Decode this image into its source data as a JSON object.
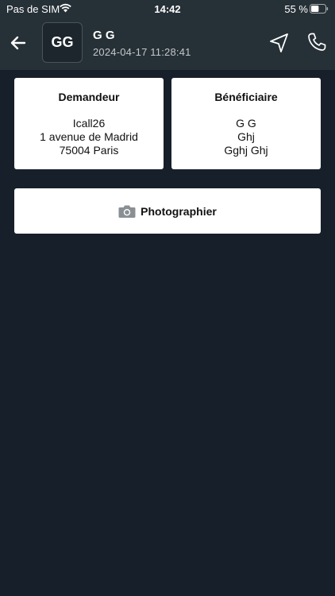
{
  "status_bar": {
    "carrier": "Pas de SIM",
    "time": "14:42",
    "battery_percent": "55 %",
    "battery_level": 0.55
  },
  "header": {
    "avatar_initials": "GG",
    "title": "G G",
    "timestamp": "2024-04-17 11:28:41"
  },
  "requester": {
    "heading": "Demandeur",
    "lines": [
      "Icall26",
      "1 avenue de Madrid",
      "75004 Paris"
    ]
  },
  "beneficiary": {
    "heading": "Bénéficiaire",
    "lines": [
      "G G",
      "Ghj",
      "Gghj Ghj"
    ]
  },
  "photo_button": {
    "label": "Photographier"
  },
  "icons": {
    "back": "arrow-left-icon",
    "navigate": "navigation-arrow-icon",
    "call": "phone-icon",
    "camera": "camera-icon",
    "wifi": "wifi-icon",
    "battery": "battery-icon"
  },
  "colors": {
    "background": "#17202a",
    "header": "#263037",
    "card": "#ffffff",
    "camera_icon": "#8a8f93"
  }
}
